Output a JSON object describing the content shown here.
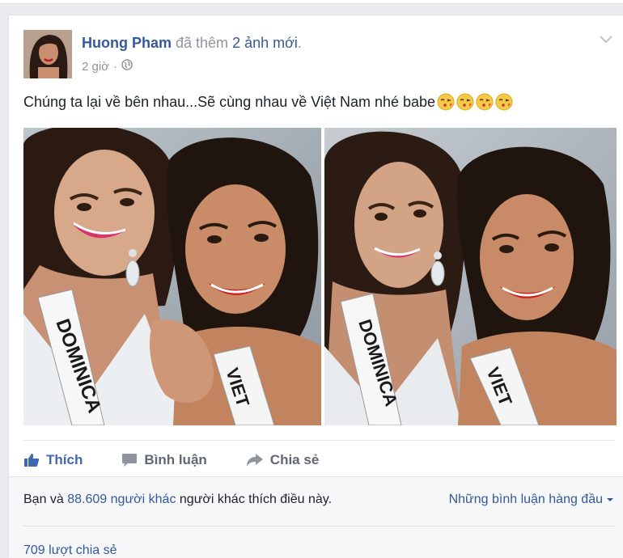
{
  "post": {
    "author": "Huong Pham",
    "added_text": "đã thêm",
    "photo_count_text": "2 ảnh mới",
    "period": ".",
    "time": "2 giờ",
    "separator": "·",
    "privacy_icon": "globe-icon",
    "menu_icon": "chevron-down-icon",
    "text": "Chúng ta lại về bên nhau...Sẽ cùng nhau về Việt Nam nhé babe",
    "emoji_icon": "kiss-face-emoji",
    "emoji_count": 4
  },
  "actions": {
    "like_label": "Thích",
    "comment_label": "Bình luận",
    "share_label": "Chia sẻ",
    "like_color": "#4267b2"
  },
  "footer": {
    "likes_prefix": "Bạn và",
    "likes_link": "88.609 người khác",
    "likes_suffix": "người khác thích điều này.",
    "top_comments": "Những bình luận hàng đầu",
    "shares": "709 lượt chia sẻ"
  },
  "colors": {
    "link": "#365899",
    "muted": "#90949c",
    "text": "#1d2129",
    "background": "#e9ebee"
  }
}
